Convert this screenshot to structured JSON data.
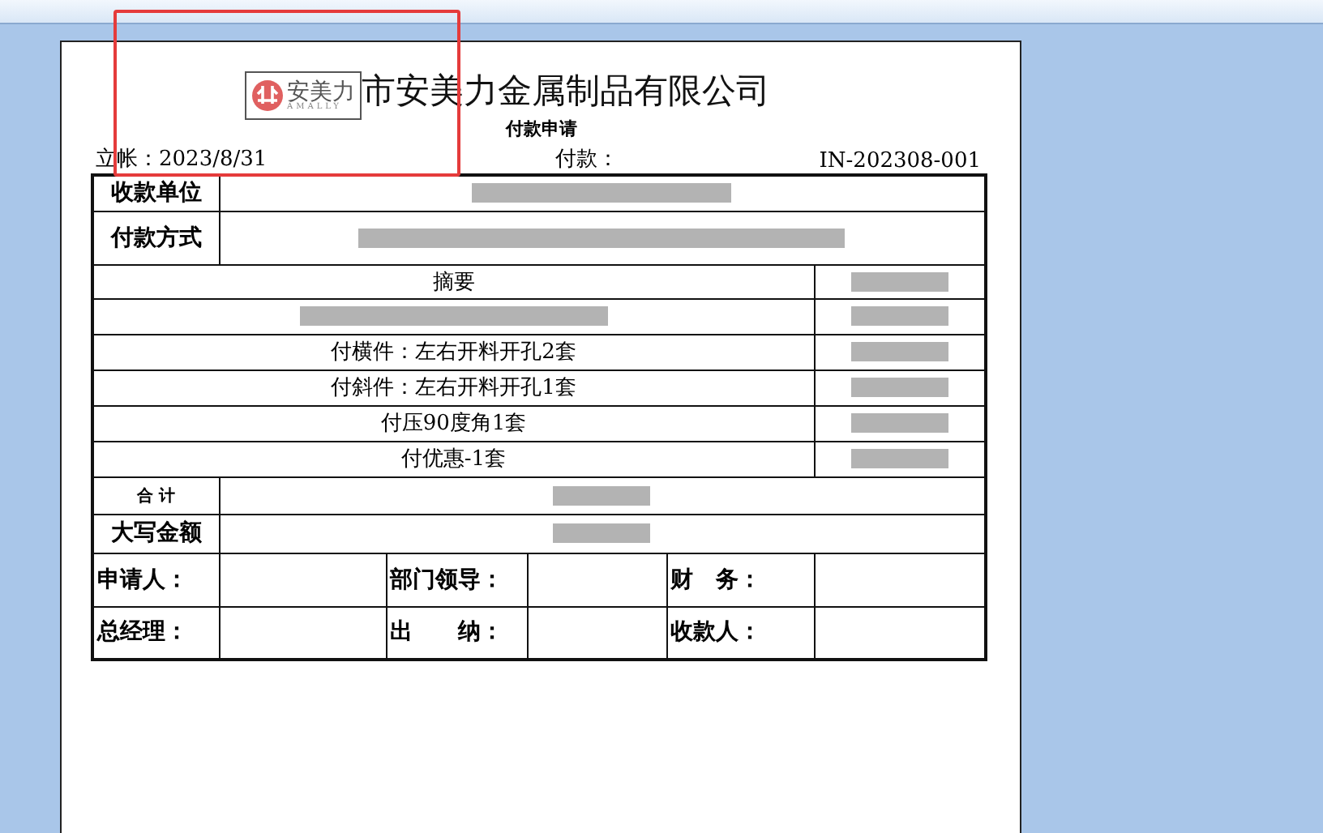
{
  "company_name": "市安美力金属制品有限公司",
  "logo": {
    "text": "安美力",
    "subtext": "AMALLY"
  },
  "form_title": "付款申请",
  "header": {
    "date_label": "立帐：2023/8/31",
    "payment_label": "付款：",
    "document_no": "IN-202308-001"
  },
  "payee_label": "收款单位",
  "payment_method_label": "付款方式",
  "summary_header": "摘要",
  "items": [
    {
      "kind": "redacted"
    },
    {
      "kind": "text",
      "description": "付横件：左右开料开孔2套"
    },
    {
      "kind": "text",
      "description": "付斜件：左右开料开孔1套"
    },
    {
      "kind": "text",
      "description": "付压90度角1套"
    },
    {
      "kind": "text",
      "description": "付优惠-1套"
    }
  ],
  "total_label": "合 计",
  "amount_in_words_label": "大写金额",
  "signatures": [
    [
      "申请人：",
      "部门领导：",
      "财　务："
    ],
    [
      "总经理：",
      "出　　纳：",
      "收款人："
    ]
  ]
}
